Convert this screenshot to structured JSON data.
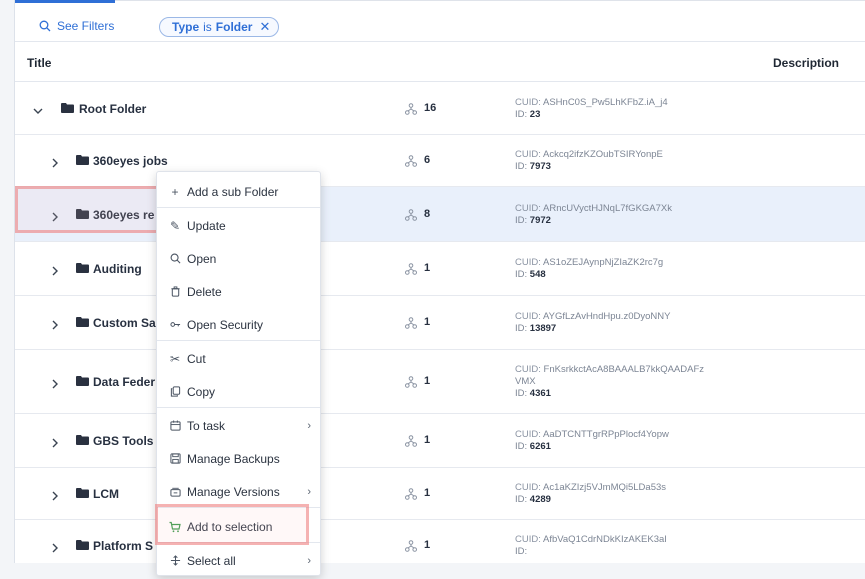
{
  "filters": {
    "see_filters_label": "See Filters",
    "chip_field": "Type",
    "chip_op": "is",
    "chip_value": "Folder",
    "chip_remove": "✕"
  },
  "table": {
    "col_title": "Title",
    "col_description": "Description"
  },
  "rows": [
    {
      "name": "Root Folder",
      "count": "16",
      "cuid_label": "CUID:",
      "cuid": "ASHnC0S_Pw5LhKFbZ.iA_j4",
      "id_label": "ID:",
      "id": "23"
    },
    {
      "name": "360eyes jobs",
      "count": "6",
      "cuid_label": "CUID:",
      "cuid": "Ackcq2ifzKZOubTSIRYonpE",
      "id_label": "ID:",
      "id": "7973"
    },
    {
      "name": "360eyes re",
      "count": "8",
      "cuid_label": "CUID:",
      "cuid": "ARncUVyctHJNqL7fGKGA7Xk",
      "id_label": "ID:",
      "id": "7972"
    },
    {
      "name": "Auditing",
      "count": "1",
      "cuid_label": "CUID:",
      "cuid": "AS1oZEJAynpNjZIaZK2rc7g",
      "id_label": "ID:",
      "id": "548"
    },
    {
      "name": "Custom Sa",
      "count": "1",
      "cuid_label": "CUID:",
      "cuid": "AYGfLzAvHndHpu.z0DyoNNY",
      "id_label": "ID:",
      "id": "13897"
    },
    {
      "name": "Data Feder",
      "count": "1",
      "cuid_label": "CUID:",
      "cuid": "FnKsrkkctAcA8BAAALB7kkQAADAFz",
      "cuid2": "VMX",
      "id_label": "ID:",
      "id": "4361"
    },
    {
      "name": "GBS Tools",
      "count": "1",
      "cuid_label": "CUID:",
      "cuid": "AaDTCNTTgrRPpPlocf4Yopw",
      "id_label": "ID:",
      "id": "6261"
    },
    {
      "name": "LCM",
      "count": "1",
      "cuid_label": "CUID:",
      "cuid": "Ac1aKZIzj5VJmMQi5LDa53s",
      "id_label": "ID:",
      "id": "4289"
    },
    {
      "name": "Platform S",
      "count": "1",
      "cuid_label": "CUID:",
      "cuid": "AfbVaQ1CdrNDkKIzAKEK3aI",
      "id_label": "ID:",
      "id": ""
    }
  ],
  "context_menu": {
    "add_sub_folder": "Add a sub Folder",
    "update": "Update",
    "open": "Open",
    "delete": "Delete",
    "open_security": "Open Security",
    "cut": "Cut",
    "copy": "Copy",
    "to_task": "To task",
    "manage_backups": "Manage Backups",
    "manage_versions": "Manage Versions",
    "add_to_selection": "Add to selection",
    "select_all": "Select all",
    "submenu_arrow": "›"
  },
  "colors": {
    "accent": "#2f6fd6",
    "selected_row": "#e9f0fb",
    "highlight": "#ec7878",
    "add_to_selection_icon": "#3a9a4a"
  }
}
